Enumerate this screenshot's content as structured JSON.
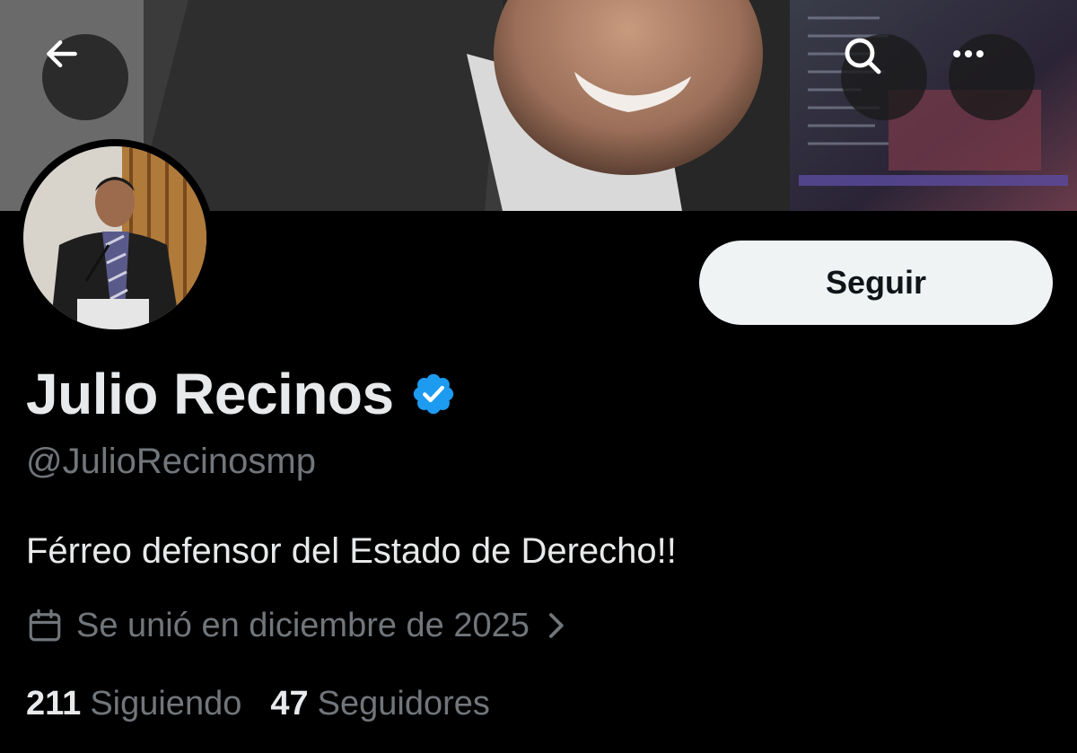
{
  "profile": {
    "display_name": "Julio Recinos",
    "handle": "@JulioRecinosmp",
    "bio": "Férreo defensor del Estado de Derecho!!",
    "joined": "Se unió en diciembre de 2025",
    "following_count": "211",
    "following_label": "Siguiendo",
    "followers_count": "47",
    "followers_label": "Seguidores",
    "verified": true
  },
  "actions": {
    "follow_label": "Seguir"
  },
  "icons": {
    "back": "arrow-left-icon",
    "search": "search-icon",
    "more": "more-horizontal-icon",
    "verified": "verified-badge-icon",
    "calendar": "calendar-icon",
    "chevron": "chevron-right-icon"
  },
  "colors": {
    "background": "#000000",
    "primary_text": "#e7e9ea",
    "secondary_text": "#71767b",
    "verified_blue": "#1d9bf0",
    "follow_button_bg": "#eff3f4",
    "follow_button_text": "#0f1419"
  }
}
